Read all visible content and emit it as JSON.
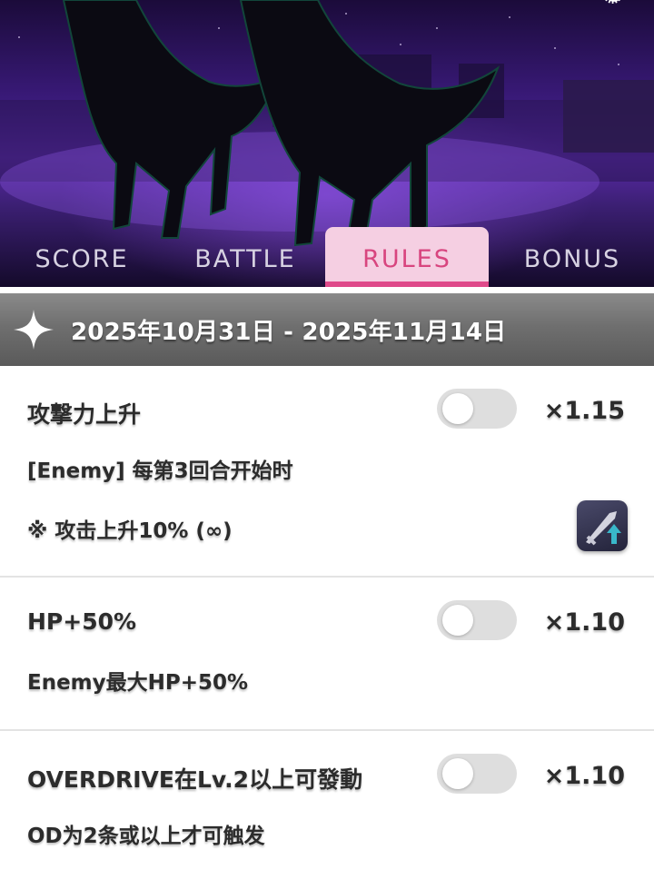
{
  "tabs": [
    {
      "label": "SCORE",
      "active": false
    },
    {
      "label": "BATTLE",
      "active": false
    },
    {
      "label": "RULES",
      "active": true
    },
    {
      "label": "BONUS",
      "active": false
    }
  ],
  "period": {
    "date_range": "2025年10月31日 - 2025年11月14日",
    "icon": "sparkle-icon"
  },
  "rules": [
    {
      "title": "攻撃力上升",
      "multiplier": "×1.15",
      "enabled": false,
      "lines": [
        "[Enemy] 每第3回合开始时",
        "※ 攻击上升10% (∞)"
      ],
      "icon": "sword-attack-up-icon"
    },
    {
      "title": "HP+50%",
      "multiplier": "×1.10",
      "enabled": false,
      "lines": [
        "Enemy最大HP+50%"
      ]
    },
    {
      "title": "OVERDRIVE在Lv.2以上可發動",
      "multiplier": "×1.10",
      "enabled": false,
      "lines": [
        "OD为2条或以上才可触发"
      ]
    }
  ],
  "colors": {
    "accent_pink": "#df4a8a",
    "tab_active_bg": "#f5cfe2",
    "header_gray": "#6f6f6f"
  }
}
